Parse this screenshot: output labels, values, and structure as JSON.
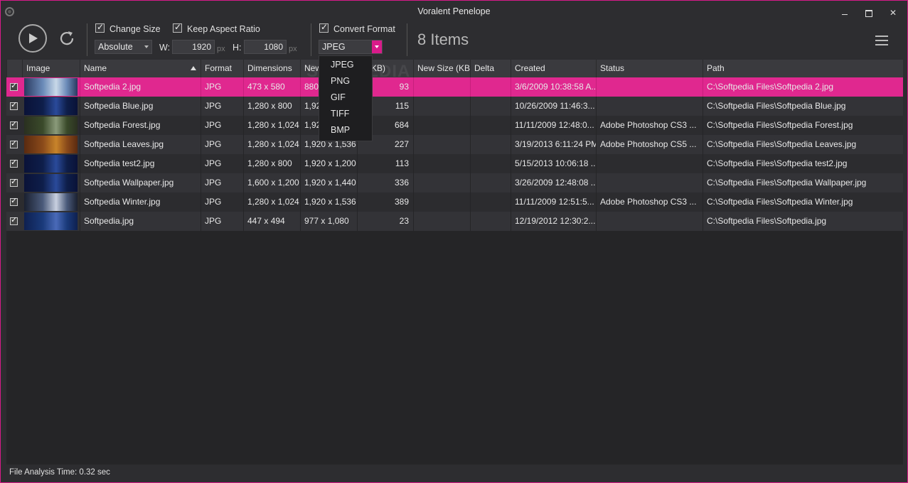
{
  "window": {
    "title": "Voralent Penelope"
  },
  "toolbar": {
    "change_size_label": "Change Size",
    "keep_aspect_label": "Keep Aspect Ratio",
    "convert_format_label": "Convert Format",
    "size_mode": "Absolute",
    "width_label": "W:",
    "width_value": "1920",
    "height_label": "H:",
    "height_value": "1080",
    "unit": "px",
    "format_value": "JPEG",
    "items_count": "8 Items"
  },
  "format_options": [
    "JPEG",
    "PNG",
    "GIF",
    "TIFF",
    "BMP"
  ],
  "grid": {
    "columns": [
      "Image",
      "Name",
      "Format",
      "Dimensions",
      "New",
      "e (KB)",
      "New Size (KB)",
      "Delta",
      "Created",
      "Status",
      "Path"
    ],
    "rows": [
      {
        "name": "Softpedia 2.jpg",
        "format": "JPG",
        "dim": "473 x 580",
        "newdim": "880",
        "size": "93",
        "created": "3/6/2009 10:38:58 A...",
        "status": "",
        "path": "C:\\Softpedia Files\\Softpedia 2.jpg",
        "thumb": [
          "#6a8ab8",
          "#c8d8e8",
          "#2a3a60"
        ]
      },
      {
        "name": "Softpedia Blue.jpg",
        "format": "JPG",
        "dim": "1,280 x 800",
        "newdim": "1,920",
        "size": "115",
        "created": "10/26/2009 11:46:3...",
        "status": "",
        "path": "C:\\Softpedia Files\\Softpedia Blue.jpg",
        "thumb": [
          "#0e1e4a",
          "#2a4a9a",
          "#0a1238"
        ]
      },
      {
        "name": "Softpedia Forest.jpg",
        "format": "JPG",
        "dim": "1,280 x 1,024",
        "newdim": "1,92",
        "size": "684",
        "created": "11/11/2009 12:48:0...",
        "status": "Adobe Photoshop CS3 ...",
        "path": "C:\\Softpedia Files\\Softpedia Forest.jpg",
        "thumb": [
          "#3a4a2a",
          "#8a9a7a",
          "#2a3020"
        ]
      },
      {
        "name": "Softpedia Leaves.jpg",
        "format": "JPG",
        "dim": "1,280 x 1,024",
        "newdim": "1,920 x 1,536",
        "size": "227",
        "created": "3/19/2013 6:11:24 PM",
        "status": "Adobe Photoshop CS5 ...",
        "path": "C:\\Softpedia Files\\Softpedia Leaves.jpg",
        "thumb": [
          "#8a4a1a",
          "#c8842a",
          "#5a2a10"
        ]
      },
      {
        "name": "Softpedia test2.jpg",
        "format": "JPG",
        "dim": "1,280 x 800",
        "newdim": "1,920 x 1,200",
        "size": "113",
        "created": "5/15/2013 10:06:18 ...",
        "status": "",
        "path": "C:\\Softpedia Files\\Softpedia test2.jpg",
        "thumb": [
          "#0e1e4a",
          "#2a4a9a",
          "#0a1238"
        ]
      },
      {
        "name": "Softpedia Wallpaper.jpg",
        "format": "JPG",
        "dim": "1,600 x 1,200",
        "newdim": "1,920 x 1,440",
        "size": "336",
        "created": "3/26/2009 12:48:08 ...",
        "status": "",
        "path": "C:\\Softpedia Files\\Softpedia Wallpaper.jpg",
        "thumb": [
          "#0e1e4a",
          "#2a4a9a",
          "#0a1238"
        ]
      },
      {
        "name": "Softpedia Winter.jpg",
        "format": "JPG",
        "dim": "1,280 x 1,024",
        "newdim": "1,920 x 1,536",
        "size": "389",
        "created": "11/11/2009 12:51:5...",
        "status": "Adobe Photoshop CS3 ...",
        "path": "C:\\Softpedia Files\\Softpedia Winter.jpg",
        "thumb": [
          "#4a5a7a",
          "#c8d0e0",
          "#1a2030"
        ]
      },
      {
        "name": "Softpedia.jpg",
        "format": "JPG",
        "dim": "447 x 494",
        "newdim": "977 x 1,080",
        "size": "23",
        "created": "12/19/2012 12:30:2...",
        "status": "",
        "path": "C:\\Softpedia Files\\Softpedia.jpg",
        "thumb": [
          "#1a3a7a",
          "#4a6ab8",
          "#0e2050"
        ]
      }
    ]
  },
  "status": {
    "analysis_time": "File Analysis Time: 0.32 sec"
  },
  "watermark": "SOFTPEDIA",
  "colors": {
    "accent": "#e0288f",
    "background": "#2d2d30"
  }
}
